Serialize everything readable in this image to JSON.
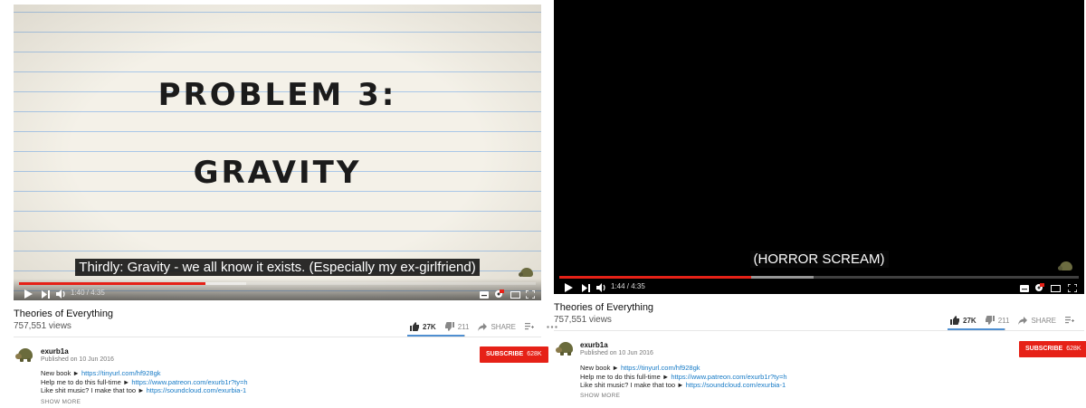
{
  "left": {
    "title_line1": "PROBLEM 3:",
    "title_line2": "GRAVITY",
    "caption": "Thirdly: Gravity - we all know it exists. (Especially my ex-girlfriend)",
    "time": "1:40 / 4:35",
    "progress": {
      "played": 0.36,
      "buffered": 0.44
    },
    "video_title": "Theories of Everything",
    "views": "757,551 views",
    "likes": "27K",
    "dislikes": "211",
    "share_label": "SHARE",
    "channel": "exurb1a",
    "published": "Published on 10 Jun 2016",
    "subscribe_label": "SUBSCRIBE",
    "subscriber_count": "628K",
    "desc": [
      {
        "text": "New book ► ",
        "link": "https://tinyurl.com/hf928gk"
      },
      {
        "text": "Help me to do this full-time ► ",
        "link": "https://www.patreon.com/exurb1r?ty=h"
      },
      {
        "text": "Like shit music? I make that too ► ",
        "link": "https://soundcloud.com/exurbia-1"
      }
    ],
    "show_more": "SHOW MORE"
  },
  "right": {
    "caption": "(HORROR SCREAM)",
    "time": "1:44 / 4:35",
    "progress": {
      "played": 0.37,
      "buffered": 0.49
    },
    "video_title": "Theories of Everything",
    "views": "757,551 views",
    "likes": "27K",
    "dislikes": "211",
    "share_label": "SHARE",
    "channel": "exurb1a",
    "published": "Published on 10 Jun 2016",
    "subscribe_label": "SUBSCRIBE",
    "subscriber_count": "628K",
    "desc": [
      {
        "text": "New book ► ",
        "link": "https://tinyurl.com/hf928gk"
      },
      {
        "text": "Help me to do this full-time ► ",
        "link": "https://www.patreon.com/exurb1r?ty=h"
      },
      {
        "text": "Like shit music? I make that too ► ",
        "link": "https://soundcloud.com/exurbia-1"
      }
    ],
    "show_more": "SHOW MORE"
  },
  "colors": {
    "accent_red": "#e62117",
    "link": "#167ac6",
    "like_bar": "#4f8fd1"
  },
  "icons": [
    "play-icon",
    "next-icon",
    "volume-icon",
    "subtitles-icon",
    "settings-icon",
    "miniplayer-icon",
    "theater-icon",
    "fullscreen-icon",
    "thumbs-up-icon",
    "thumbs-down-icon",
    "share-icon",
    "add-to-playlist-icon",
    "more-icon",
    "channel-avatar",
    "channel-watermark"
  ]
}
